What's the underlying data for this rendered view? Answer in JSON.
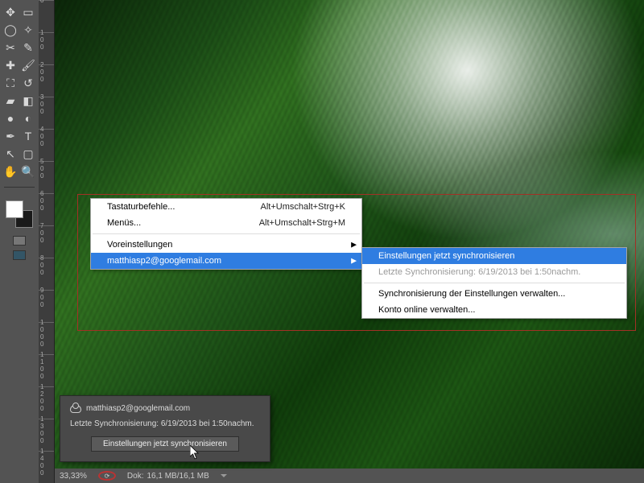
{
  "toolbar": {
    "tools": [
      [
        "move",
        "rect-select"
      ],
      [
        "lasso",
        "magic-wand"
      ],
      [
        "crop",
        "eyedropper"
      ],
      [
        "heal",
        "brush"
      ],
      [
        "stamp",
        "history-brush"
      ],
      [
        "eraser",
        "gradient"
      ],
      [
        "blur",
        "dodge"
      ],
      [
        "pen",
        "type"
      ],
      [
        "path-select",
        "shape"
      ],
      [
        "hand",
        "zoom"
      ]
    ],
    "swatch_front": "#ffffff",
    "swatch_back": "#1a1a1a"
  },
  "ruler": {
    "marks": [
      0,
      100,
      200,
      300,
      400,
      500,
      600,
      700,
      800,
      900,
      1000,
      1100,
      1200,
      1300,
      1400
    ]
  },
  "context_menu": {
    "items": [
      {
        "label": "Tastaturbefehle...",
        "shortcut": "Alt+Umschalt+Strg+K",
        "has_sub": false
      },
      {
        "label": "Menüs...",
        "shortcut": "Alt+Umschalt+Strg+M",
        "has_sub": false
      },
      {
        "label": "Voreinstellungen",
        "shortcut": "",
        "has_sub": true
      },
      {
        "label": "matthiasp2@googlemail.com",
        "shortcut": "",
        "has_sub": true,
        "highlight": true
      }
    ]
  },
  "sub_menu": {
    "items": [
      {
        "label": "Einstellungen jetzt synchronisieren",
        "highlight": true,
        "disabled": false
      },
      {
        "label": "Letzte Synchronisierung: 6/19/2013 bei 1:50nachm.",
        "disabled": true
      },
      {
        "label": "Synchronisierung der Einstellungen verwalten...",
        "disabled": false
      },
      {
        "label": "Konto online verwalten...",
        "disabled": false
      }
    ],
    "sep_after_index": 1
  },
  "popup": {
    "account": "matthiasp2@googlemail.com",
    "last_sync": "Letzte Synchronisierung: 6/19/2013 bei 1:50nachm.",
    "button": "Einstellungen jetzt synchronisieren"
  },
  "statusbar": {
    "zoom": "33,33%",
    "doc_label": "Dok:",
    "doc_value": "16,1 MB/16,1 MB"
  },
  "icons": {
    "arrow_right": "▶",
    "arrow_down": "▼"
  }
}
